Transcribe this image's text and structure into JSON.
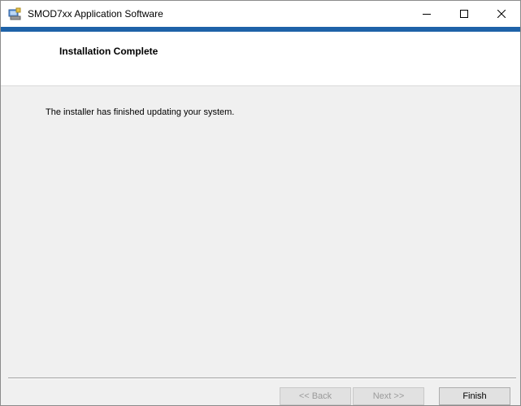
{
  "window": {
    "title": "SMOD7xx Application Software",
    "icon": "installer-app-icon",
    "controls": {
      "minimize_icon": "minimize-icon",
      "maximize_icon": "maximize-icon",
      "close_icon": "close-icon"
    },
    "accent_color": "#1e62a8"
  },
  "banner": {
    "title": "Installation Complete"
  },
  "content": {
    "message": "The installer has finished updating your system."
  },
  "buttons": {
    "back_label": "<< Back",
    "next_label": "Next >>",
    "finish_label": "Finish"
  }
}
